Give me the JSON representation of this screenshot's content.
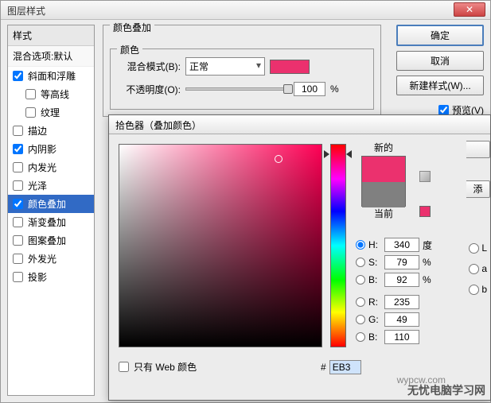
{
  "main": {
    "title": "图层样式",
    "styles_header": "样式",
    "blend_defaults": "混合选项:默认",
    "items": [
      {
        "label": "斜面和浮雕",
        "checked": true,
        "indent": false
      },
      {
        "label": "等高线",
        "checked": false,
        "indent": true
      },
      {
        "label": "纹理",
        "checked": false,
        "indent": true
      },
      {
        "label": "描边",
        "checked": false,
        "indent": false
      },
      {
        "label": "内阴影",
        "checked": true,
        "indent": false
      },
      {
        "label": "内发光",
        "checked": false,
        "indent": false
      },
      {
        "label": "光泽",
        "checked": false,
        "indent": false
      },
      {
        "label": "颜色叠加",
        "checked": true,
        "indent": false,
        "selected": true
      },
      {
        "label": "渐变叠加",
        "checked": false,
        "indent": false
      },
      {
        "label": "图案叠加",
        "checked": false,
        "indent": false
      },
      {
        "label": "外发光",
        "checked": false,
        "indent": false
      },
      {
        "label": "投影",
        "checked": false,
        "indent": false
      }
    ]
  },
  "overlay": {
    "group_title": "颜色叠加",
    "fieldset_title": "颜色",
    "blend_label": "混合模式(B):",
    "blend_value": "正常",
    "opacity_label": "不透明度(O):",
    "opacity_value": "100",
    "opacity_unit": "%",
    "swatch_color": "#eb316e"
  },
  "buttons": {
    "ok": "确定",
    "cancel": "取消",
    "new_style": "新建样式(W)...",
    "preview": "预览(V)"
  },
  "picker": {
    "title": "拾色器（叠加颜色）",
    "new_label": "新的",
    "current_label": "当前",
    "add_label": "添",
    "h": {
      "label": "H:",
      "value": "340",
      "unit": "度"
    },
    "s": {
      "label": "S:",
      "value": "79",
      "unit": "%"
    },
    "b": {
      "label": "B:",
      "value": "92",
      "unit": "%"
    },
    "r": {
      "label": "R:",
      "value": "235"
    },
    "g": {
      "label": "G:",
      "value": "49"
    },
    "bch": {
      "label": "B:",
      "value": "110"
    },
    "extra": {
      "l": "L",
      "a": "a",
      "b": "b"
    },
    "web_only": "只有 Web 颜色",
    "hex_prefix": "#",
    "hex_value": "EB3"
  },
  "watermark": {
    "main": "无忧电脑学习网",
    "sub": "wypcw.com"
  }
}
